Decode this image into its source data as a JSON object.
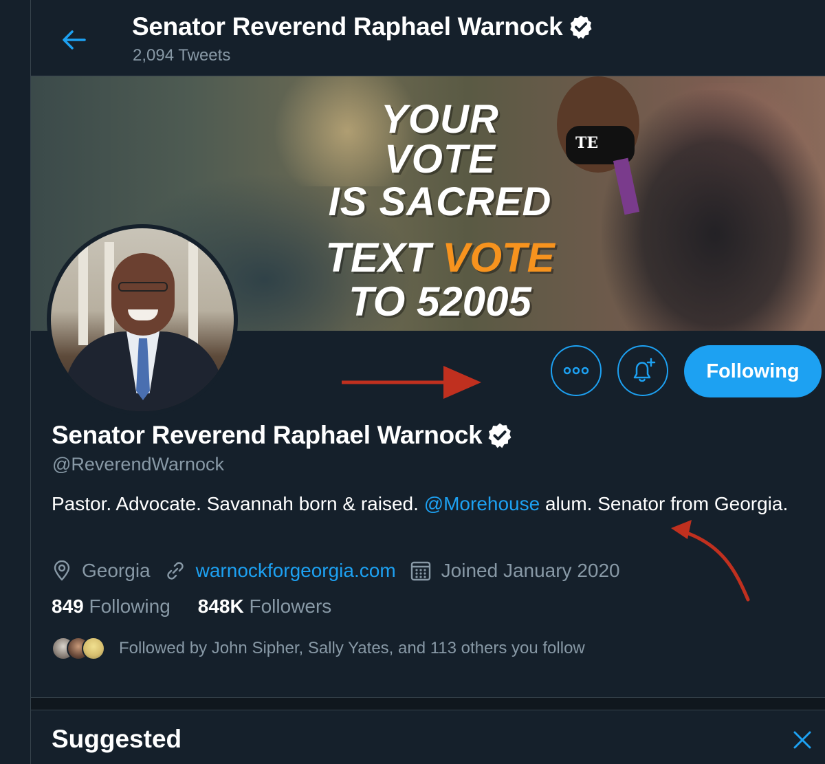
{
  "header": {
    "title": "Senator Reverend Raphael Warnock",
    "tweet_count": "2,094 Tweets"
  },
  "banner": {
    "line1": "YOUR VOTE",
    "line2": "IS SACRED",
    "line3_prefix": "TEXT ",
    "line3_highlight": "VOTE",
    "line4": "TO 52005",
    "mask_text": "TE",
    "highlight_color": "#f7931e"
  },
  "actions": {
    "more_icon": "more-icon",
    "notify_icon": "bell-plus-icon",
    "following_label": "Following"
  },
  "profile": {
    "name": "Senator Reverend Raphael Warnock",
    "handle": "@ReverendWarnock",
    "bio_before": "Pastor. Advocate. Savannah born & raised. ",
    "bio_mention": "@Morehouse",
    "bio_after": " alum. Senator from Georgia.",
    "location": "Georgia",
    "website": "warnockforgeorgia.com",
    "joined": "Joined January 2020",
    "following_count": "849",
    "following_label": "Following",
    "followers_count": "848K",
    "followers_label": "Followers",
    "followed_by": "Followed by John Sipher, Sally Yates, and 113 others you follow"
  },
  "suggested": {
    "title": "Suggested"
  },
  "colors": {
    "background": "#15202b",
    "accent": "#1da1f2",
    "muted": "#8899a6",
    "annotation_arrow": "#c0301f"
  }
}
